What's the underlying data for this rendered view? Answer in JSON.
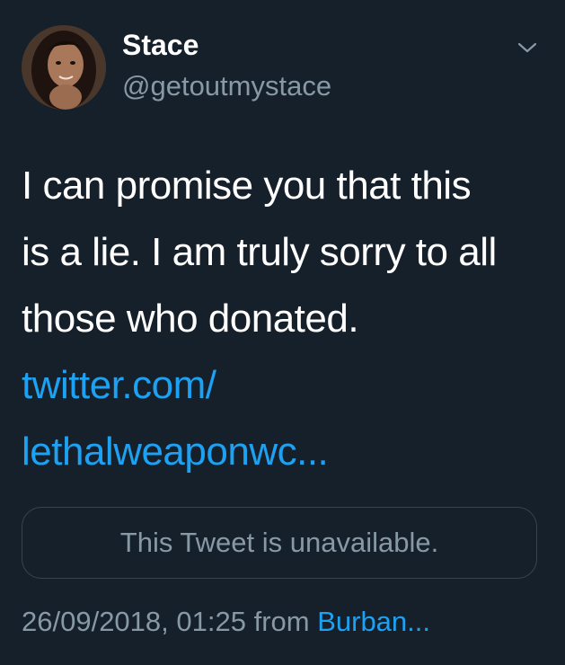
{
  "author": {
    "display_name": "Stace",
    "handle": "@getoutmystace"
  },
  "tweet": {
    "text_lines": [
      "I can promise you that this",
      "is a lie. I am truly sorry to all",
      "those who donated."
    ],
    "link_lines": [
      "twitter.com/",
      "lethalweaponwc..."
    ],
    "quoted_tweet_text": "This Tweet is unavailable.",
    "timestamp": "26/09/2018, 01:25",
    "from_label": "from",
    "source": "Burban..."
  },
  "icons": {
    "menu": "chevron-down-icon",
    "avatar": "profile-photo"
  },
  "colors": {
    "background": "#15202b",
    "text_primary": "#ffffff",
    "text_secondary": "#8899a6",
    "link": "#1da1f2",
    "border": "#38444d"
  }
}
